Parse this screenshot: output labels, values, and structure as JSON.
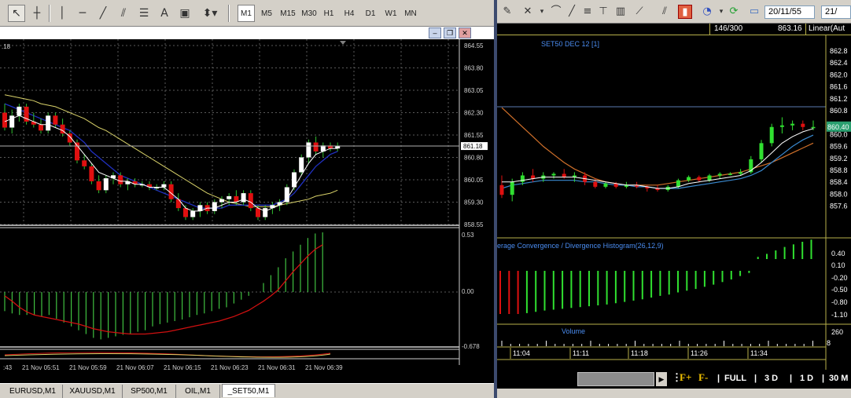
{
  "mt4": {
    "toolbar": {
      "tools": [
        "cursor-icon",
        "crosshair-icon",
        "vertical-line-icon",
        "horizontal-line-icon",
        "trendline-icon",
        "channel-icon",
        "fibonacci-icon",
        "text-icon",
        "label-icon",
        "arrows-icon"
      ],
      "text_tool_label": "A",
      "timeframes": [
        "M1",
        "M5",
        "M15",
        "M30",
        "H1",
        "H4",
        "D1",
        "W1",
        "MN"
      ],
      "active_timeframe": "M1"
    },
    "window_buttons": {
      "minimize": "‒",
      "restore": "❐",
      "close": "✕"
    },
    "tabs": [
      "EURUSD,M1",
      "XAUUSD,M1",
      "SP500,M1",
      "OIL,M1",
      "_SET50,M1"
    ],
    "active_tab": "_SET50,M1",
    "chart_data": {
      "type": "candlestick",
      "price_axis": {
        "ticks": [
          864.55,
          863.8,
          863.05,
          862.3,
          861.55,
          860.8,
          860.05,
          859.3,
          858.55
        ],
        "ylim": [
          858.55,
          864.55
        ]
      },
      "current_price": 861.18,
      "top_fragment": ".18",
      "time_labels": [
        ":43",
        "21 Nov 05:51",
        "21 Nov 05:59",
        "21 Nov 06:07",
        "21 Nov 06:15",
        "21 Nov 06:23",
        "21 Nov 06:31",
        "21 Nov 06:39"
      ],
      "candles": [
        [
          862.3,
          862.6,
          861.7,
          861.8
        ],
        [
          861.8,
          862.4,
          861.6,
          862.2
        ],
        [
          862.2,
          862.6,
          862.0,
          862.5
        ],
        [
          862.5,
          862.6,
          861.9,
          862.0
        ],
        [
          862.0,
          862.3,
          861.8,
          861.9
        ],
        [
          861.9,
          862.1,
          861.6,
          861.7
        ],
        [
          861.7,
          862.3,
          861.6,
          862.2
        ],
        [
          862.2,
          862.3,
          861.8,
          861.9
        ],
        [
          861.9,
          862.1,
          861.5,
          861.6
        ],
        [
          861.6,
          861.7,
          861.2,
          861.3
        ],
        [
          861.3,
          861.4,
          860.6,
          860.7
        ],
        [
          860.7,
          860.9,
          860.4,
          860.5
        ],
        [
          860.5,
          860.6,
          859.9,
          860.0
        ],
        [
          860.0,
          860.2,
          859.6,
          859.7
        ],
        [
          859.7,
          860.2,
          859.6,
          860.1
        ],
        [
          860.1,
          860.3,
          859.9,
          860.2
        ],
        [
          860.2,
          860.3,
          859.8,
          859.9
        ],
        [
          859.9,
          860.1,
          859.7,
          860.0
        ],
        [
          860.0,
          860.1,
          859.8,
          859.9
        ],
        [
          859.9,
          860.0,
          859.8,
          859.9
        ],
        [
          859.9,
          860.0,
          859.7,
          859.8
        ],
        [
          859.8,
          859.9,
          859.7,
          859.8
        ],
        [
          859.8,
          860.0,
          859.7,
          859.9
        ],
        [
          859.9,
          860.0,
          859.3,
          859.4
        ],
        [
          859.4,
          859.6,
          859.0,
          859.1
        ],
        [
          859.1,
          859.2,
          858.7,
          858.8
        ],
        [
          858.8,
          859.1,
          858.7,
          859.0
        ],
        [
          859.0,
          859.3,
          858.8,
          859.2
        ],
        [
          859.2,
          859.3,
          858.9,
          859.0
        ],
        [
          859.0,
          859.4,
          858.9,
          859.3
        ],
        [
          859.3,
          859.5,
          859.1,
          859.4
        ],
        [
          859.4,
          859.6,
          859.2,
          859.5
        ],
        [
          859.5,
          859.7,
          859.2,
          859.3
        ],
        [
          859.3,
          859.7,
          859.2,
          859.6
        ],
        [
          859.6,
          859.7,
          859.0,
          859.1
        ],
        [
          859.1,
          859.2,
          858.7,
          858.8
        ],
        [
          858.8,
          859.2,
          858.7,
          859.1
        ],
        [
          859.1,
          859.3,
          858.9,
          859.2
        ],
        [
          859.2,
          859.4,
          859.0,
          859.3
        ],
        [
          859.3,
          859.9,
          859.2,
          859.8
        ],
        [
          859.8,
          860.4,
          859.7,
          860.3
        ],
        [
          860.3,
          860.9,
          860.2,
          860.8
        ],
        [
          860.8,
          861.4,
          860.6,
          861.3
        ],
        [
          861.3,
          861.5,
          860.9,
          861.0
        ],
        [
          861.0,
          861.3,
          860.8,
          861.2
        ],
        [
          861.2,
          861.3,
          861.0,
          861.1
        ],
        [
          861.1,
          861.3,
          861.0,
          861.18
        ]
      ],
      "ma_white": [
        862.0,
        862.1,
        862.2,
        862.1,
        862.0,
        861.9,
        861.9,
        861.8,
        861.7,
        861.5,
        861.2,
        860.9,
        860.6,
        860.3,
        860.2,
        860.1,
        860.0,
        860.0,
        859.9,
        859.9,
        859.8,
        859.8,
        859.8,
        859.6,
        859.4,
        859.1,
        859.0,
        859.0,
        859.1,
        859.1,
        859.2,
        859.3,
        859.3,
        859.4,
        859.3,
        859.1,
        859.0,
        859.1,
        859.2,
        859.4,
        859.8,
        860.2,
        860.6,
        860.9,
        861.0,
        861.1,
        861.1
      ],
      "ma_blue": [
        862.6,
        862.5,
        862.4,
        862.3,
        862.2,
        862.1,
        862.0,
        861.9,
        861.8,
        861.7,
        861.5,
        861.3,
        861.0,
        860.8,
        860.6,
        860.4,
        860.2,
        860.1,
        860.0,
        859.9,
        859.8,
        859.7,
        859.6,
        859.5,
        859.4,
        859.3,
        859.2,
        859.1,
        859.1,
        859.1,
        859.1,
        859.2,
        859.2,
        859.2,
        859.2,
        859.2,
        859.2,
        859.2,
        859.3,
        859.4,
        859.6,
        859.9,
        860.2,
        860.5,
        860.7,
        860.9,
        861.0
      ],
      "ma_yellow": [
        862.9,
        862.85,
        862.8,
        862.75,
        862.7,
        862.6,
        862.55,
        862.5,
        862.4,
        862.3,
        862.2,
        862.1,
        861.95,
        861.8,
        861.7,
        861.55,
        861.4,
        861.25,
        861.1,
        860.95,
        860.8,
        860.65,
        860.5,
        860.35,
        860.2,
        860.05,
        859.9,
        859.75,
        859.6,
        859.5,
        859.4,
        859.3,
        859.25,
        859.2,
        859.15,
        859.15,
        859.15,
        859.15,
        859.2,
        859.25,
        859.3,
        859.35,
        859.4,
        859.5,
        859.55,
        859.6,
        859.7
      ],
      "macd_axis": {
        "ticks": [
          0.53,
          0.0,
          -0.678
        ]
      },
      "macd_hist": [
        -0.25,
        -0.28,
        -0.3,
        -0.3,
        -0.3,
        -0.32,
        -0.3,
        -0.35,
        -0.4,
        -0.45,
        -0.5,
        -0.55,
        -0.6,
        -0.62,
        -0.6,
        -0.58,
        -0.56,
        -0.55,
        -0.52,
        -0.5,
        -0.45,
        -0.42,
        -0.4,
        -0.38,
        -0.36,
        -0.33,
        -0.3,
        -0.28,
        -0.25,
        -0.22,
        -0.2,
        -0.15,
        -0.1,
        -0.05,
        0.0,
        0.08,
        0.15,
        0.22,
        0.3,
        0.36,
        0.42,
        0.48,
        0.52,
        0.53
      ],
      "macd_signal": [
        -0.05,
        -0.12,
        -0.2,
        -0.26,
        -0.3,
        -0.32,
        -0.34,
        -0.36,
        -0.38,
        -0.4,
        -0.42,
        -0.45,
        -0.48,
        -0.5,
        -0.52,
        -0.53,
        -0.54,
        -0.55,
        -0.55,
        -0.55,
        -0.54,
        -0.53,
        -0.52,
        -0.5,
        -0.48,
        -0.46,
        -0.44,
        -0.42,
        -0.4,
        -0.38,
        -0.35,
        -0.32,
        -0.28,
        -0.24,
        -0.18,
        -0.12,
        -0.05,
        0.02,
        0.1,
        0.18,
        0.25,
        0.32,
        0.38,
        0.42
      ]
    }
  },
  "right": {
    "toolbar": {
      "icons": [
        "draw-icon",
        "cross-tool-icon",
        "arc-icon",
        "line-tool-icon",
        "hline-icon",
        "vline-tool-icon",
        "bars-icon",
        "fan-icon",
        "trend-tool-icon",
        "chart-type-icon",
        "clock-icon",
        "refresh-icon",
        "image-icon"
      ],
      "date_from": "20/11/55",
      "date_to": "21/"
    },
    "status": {
      "count": "146/300",
      "price": "863.16",
      "mode": "Linear(Aut"
    },
    "chart_data": {
      "type": "candlestick",
      "title": "SET50 DEC 12  [1]",
      "price_labels": [
        "862.8",
        "862.4",
        "862.0",
        "861.6",
        "861.2",
        "860.8",
        "860.40",
        "860.0",
        "859.6",
        "859.2",
        "858.8",
        "858.4",
        "858.0",
        "857.6"
      ],
      "current_price": "860.40",
      "macd_title": "erage Convergence / Divergence Histogram(26,12,9)",
      "macd_labels": [
        "0.40",
        "0.10",
        "-0.20",
        "-0.50",
        "-0.80",
        "-1.10"
      ],
      "volume_title": "Volume",
      "volume_labels": [
        "260",
        "8"
      ],
      "time_labels": [
        "11:04",
        "11:11",
        "11:18",
        "11:26",
        "11:34"
      ],
      "candles": [
        [
          858.6,
          858.9,
          858.2,
          858.3
        ],
        [
          858.3,
          858.8,
          858.1,
          858.7
        ],
        [
          858.7,
          859.0,
          858.6,
          858.9
        ],
        [
          858.9,
          859.1,
          858.7,
          858.8
        ],
        [
          858.8,
          859.0,
          858.7,
          858.9
        ],
        [
          858.9,
          859.0,
          858.8,
          858.95
        ],
        [
          858.95,
          859.1,
          858.8,
          858.85
        ],
        [
          858.85,
          859.0,
          858.7,
          858.9
        ],
        [
          858.9,
          859.0,
          858.6,
          858.7
        ],
        [
          858.7,
          858.8,
          858.5,
          858.55
        ],
        [
          858.55,
          858.7,
          858.5,
          858.65
        ],
        [
          858.65,
          858.7,
          858.5,
          858.55
        ],
        [
          858.55,
          858.7,
          858.5,
          858.6
        ],
        [
          858.6,
          858.7,
          858.5,
          858.55
        ],
        [
          858.55,
          858.6,
          858.4,
          858.5
        ],
        [
          858.5,
          858.6,
          858.4,
          858.45
        ],
        [
          858.45,
          858.6,
          858.4,
          858.55
        ],
        [
          858.55,
          858.8,
          858.5,
          858.75
        ],
        [
          858.75,
          858.9,
          858.7,
          858.85
        ],
        [
          858.85,
          858.9,
          858.7,
          858.75
        ],
        [
          858.75,
          858.95,
          858.7,
          858.9
        ],
        [
          858.9,
          859.0,
          858.8,
          858.95
        ],
        [
          858.95,
          859.0,
          858.9,
          858.95
        ],
        [
          858.95,
          859.1,
          858.9,
          859.0
        ],
        [
          859.0,
          859.5,
          858.95,
          859.4
        ],
        [
          859.4,
          860.0,
          859.3,
          859.9
        ],
        [
          859.9,
          860.5,
          859.8,
          860.4
        ],
        [
          860.4,
          860.7,
          860.2,
          860.45
        ],
        [
          860.45,
          860.6,
          860.3,
          860.5
        ],
        [
          860.5,
          860.6,
          860.3,
          860.4
        ],
        [
          860.4,
          860.6,
          860.3,
          860.4
        ]
      ],
      "ma_white": [
        858.7,
        858.7,
        858.75,
        858.8,
        858.85,
        858.85,
        858.85,
        858.85,
        858.8,
        858.75,
        858.7,
        858.65,
        858.6,
        858.6,
        858.55,
        858.5,
        858.5,
        858.55,
        858.65,
        858.7,
        858.75,
        858.8,
        858.85,
        858.9,
        859.05,
        859.3,
        859.6,
        859.9,
        860.1,
        860.25,
        860.35
      ],
      "ma_blue": [
        858.5,
        858.6,
        858.65,
        858.7,
        858.75,
        858.75,
        858.75,
        858.75,
        858.7,
        858.7,
        858.65,
        858.6,
        858.6,
        858.55,
        858.55,
        858.5,
        858.5,
        858.5,
        858.55,
        858.6,
        858.65,
        858.7,
        858.75,
        858.8,
        858.9,
        859.05,
        859.3,
        859.55,
        859.8,
        860.0,
        860.15
      ],
      "ma_orange": [
        861.0,
        860.7,
        860.4,
        860.1,
        859.8,
        859.55,
        859.3,
        859.1,
        858.95,
        858.8,
        858.7,
        858.65,
        858.6,
        858.6,
        858.6,
        858.6,
        858.65,
        858.7,
        858.75,
        858.8,
        858.85,
        858.9,
        858.95,
        859.0,
        859.1,
        859.2,
        859.3,
        859.45,
        859.6,
        859.75,
        859.9
      ],
      "macd_hist": [
        -1.0,
        -1.0,
        -1.0,
        -0.98,
        -0.95,
        -0.92,
        -0.9,
        -0.88,
        -0.86,
        -0.84,
        -0.82,
        -0.8,
        -0.78,
        -0.75,
        -0.72,
        -0.69,
        -0.66,
        -0.62,
        -0.58,
        -0.55,
        -0.5,
        -0.46,
        -0.42,
        -0.37,
        -0.32,
        -0.26,
        -0.2,
        -0.12,
        -0.05,
        0.05,
        0.12,
        0.2,
        0.28,
        0.34,
        0.4,
        0.45
      ],
      "macd_hist_red_count": 3
    },
    "bottom": {
      "zoom_in": "F+",
      "zoom_out": "F-",
      "ranges": [
        "FULL",
        "3 D",
        "1 D",
        "30 M"
      ]
    }
  }
}
